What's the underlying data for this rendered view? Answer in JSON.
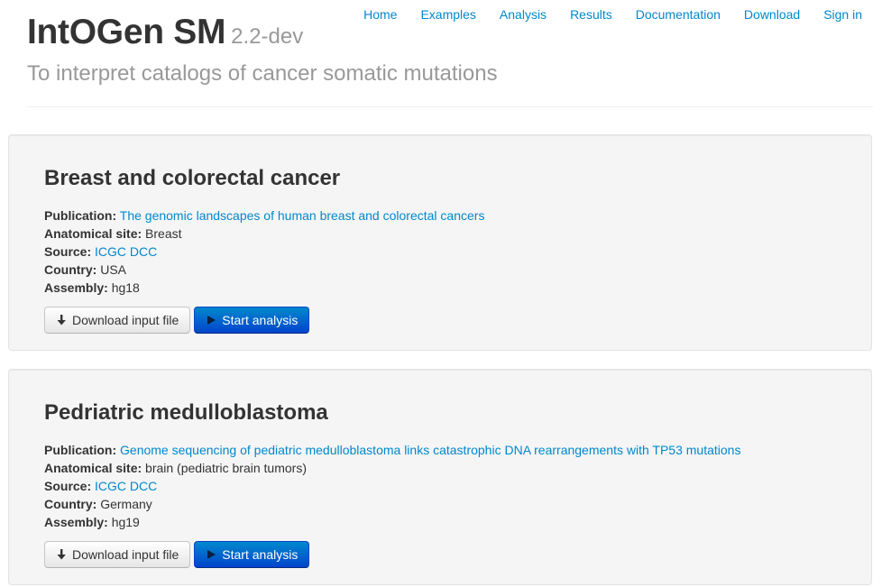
{
  "header": {
    "brand_name": "IntOGen SM",
    "version": "2.2-dev",
    "tagline": "To interpret catalogs of cancer somatic mutations"
  },
  "nav": {
    "items": [
      {
        "label": "Home"
      },
      {
        "label": "Examples"
      },
      {
        "label": "Analysis"
      },
      {
        "label": "Results"
      },
      {
        "label": "Documentation"
      },
      {
        "label": "Download"
      },
      {
        "label": "Sign in"
      }
    ]
  },
  "examples": [
    {
      "title": "Breast and colorectal cancer",
      "publication_label": "Publication:",
      "publication": "The genomic landscapes of human breast and colorectal cancers",
      "site_label": "Anatomical site:",
      "site": "Breast",
      "source_label": "Source:",
      "source": "ICGC DCC",
      "country_label": "Country:",
      "country": "USA",
      "assembly_label": "Assembly:",
      "assembly": "hg18",
      "download_label": "Download input file",
      "start_label": "Start analysis"
    },
    {
      "title": "Pedriatric medulloblastoma",
      "publication_label": "Publication:",
      "publication": "Genome sequencing of pediatric medulloblastoma links catastrophic DNA rearrangements with TP53 mutations",
      "site_label": "Anatomical site:",
      "site": "brain (pediatric brain tumors)",
      "source_label": "Source:",
      "source": "ICGC DCC",
      "country_label": "Country:",
      "country": "Germany",
      "assembly_label": "Assembly:",
      "assembly": "hg19",
      "download_label": "Download input file",
      "start_label": "Start analysis"
    }
  ],
  "icons": {
    "download": "arrow-down-icon",
    "start": "play-icon"
  },
  "colors": {
    "link": "#0088cc",
    "primary_button_top": "#0088cc",
    "primary_button_bottom": "#0044cc",
    "muted_text": "#999999",
    "card_background": "#f5f5f5"
  }
}
